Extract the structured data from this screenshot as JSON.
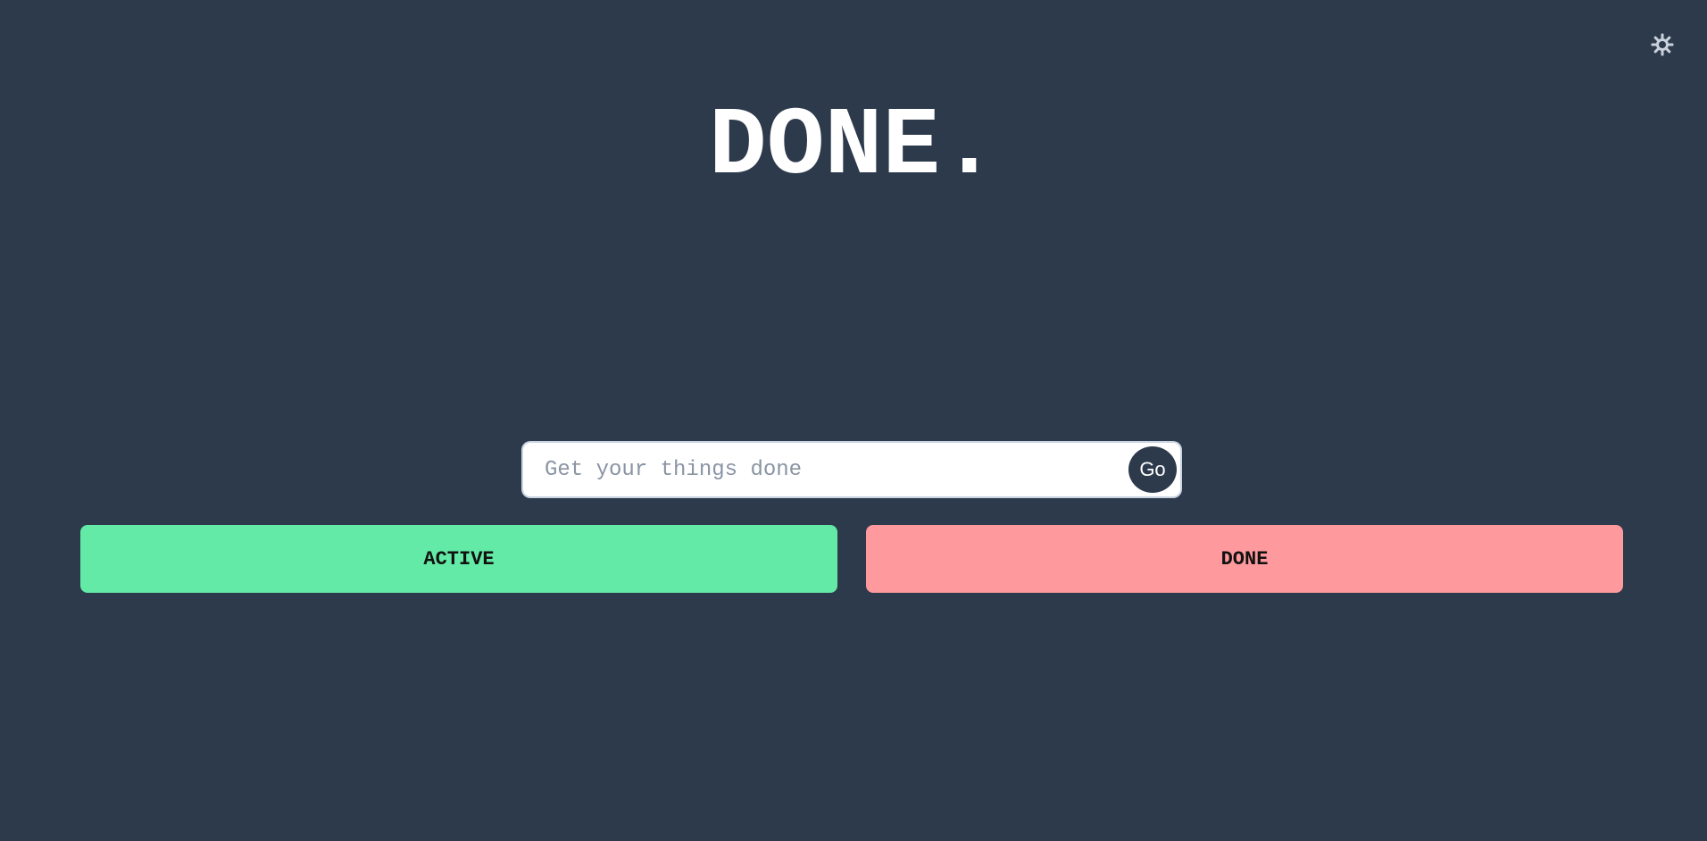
{
  "header": {
    "title": "DONE.",
    "theme_toggle_icon": "sun-icon"
  },
  "task_entry": {
    "placeholder": "Get your things done",
    "value": "",
    "submit_label": "Go"
  },
  "filters": {
    "active_label": "ACTIVE",
    "done_label": "DONE"
  },
  "colors": {
    "background": "#2d3a4c",
    "active": "#63eaa6",
    "done": "#fe9a9e",
    "title": "#ffffff"
  }
}
